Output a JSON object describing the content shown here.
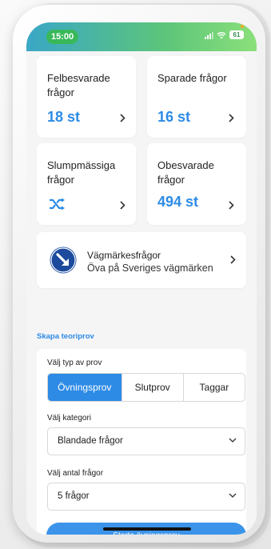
{
  "status_bar": {
    "time": "15:00",
    "battery": "61"
  },
  "cards": {
    "wrong": {
      "title": "Felbesvarade frågor",
      "value": "18 st"
    },
    "saved": {
      "title": "Sparade frågor",
      "value": "16 st"
    },
    "random": {
      "title": "Slumpmässiga frågor",
      "icon": "shuffle-icon"
    },
    "unanswered": {
      "title": "Obesvarade frågor",
      "value": "494 st"
    }
  },
  "road_signs": {
    "title": "Vägmärkesfrågor",
    "subtitle": "Öva på Sveriges vägmärken",
    "icon": "road-sign-icon"
  },
  "create_exam": {
    "section_label": "Skapa teoriprov",
    "type_label": "Välj typ av prov",
    "types": [
      "Övningsprov",
      "Slutprov",
      "Taggar"
    ],
    "selected_type": "Övningsprov",
    "category_label": "Välj kategori",
    "category_value": "Blandade frågor",
    "count_label": "Välj antal frågor",
    "count_value": "5 frågor",
    "start_button": "Starta övningsprov"
  },
  "colors": {
    "accent": "#2d8be6",
    "button": "#3b94ea",
    "background": "#f5f5f6"
  }
}
